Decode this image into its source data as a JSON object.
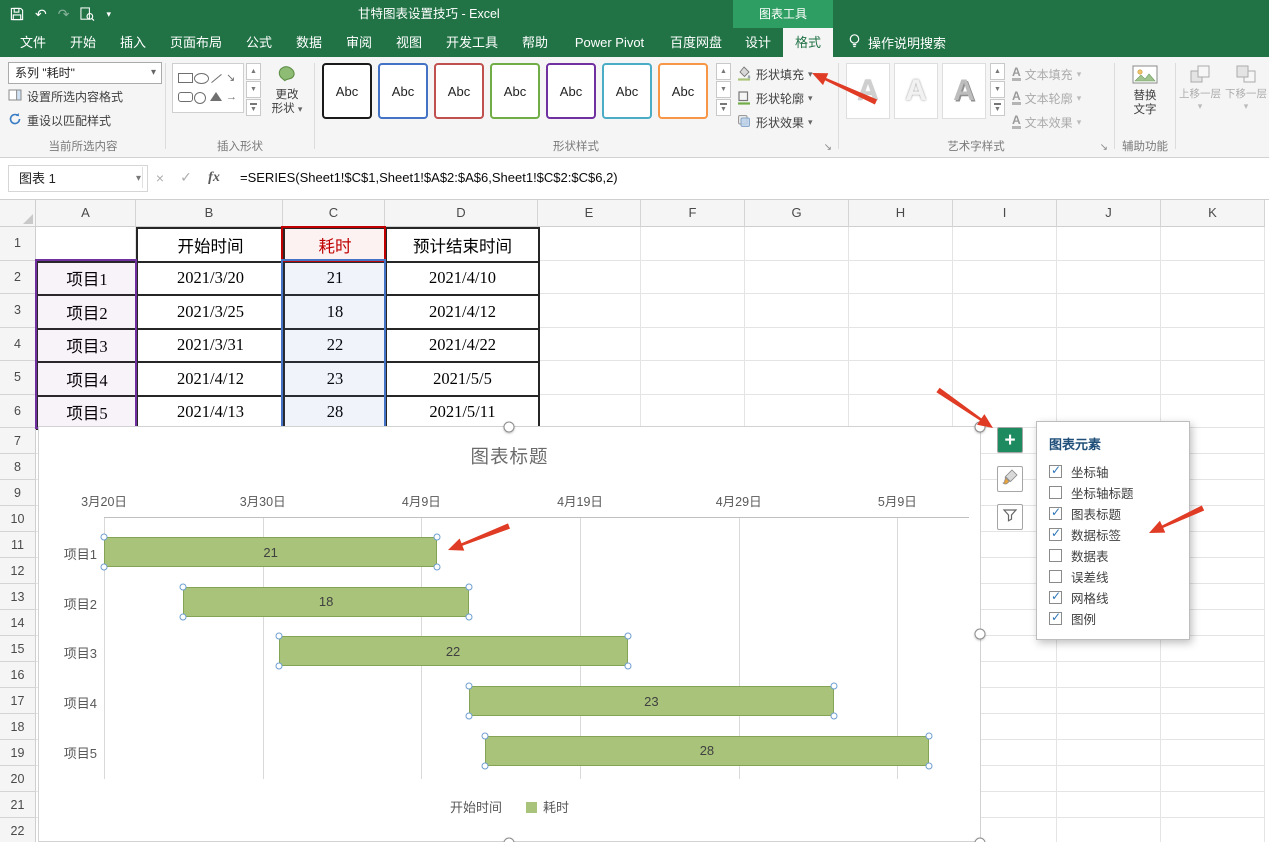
{
  "titlebar": {
    "title": "甘特图表设置技巧 - Excel",
    "contextual_group": "图表工具",
    "qat_icons": [
      "save-icon",
      "undo-icon",
      "redo-icon",
      "print-preview-icon",
      "qat-customize-icon"
    ]
  },
  "tabs": {
    "items": [
      {
        "id": "file",
        "label": "文件"
      },
      {
        "id": "home",
        "label": "开始"
      },
      {
        "id": "insert",
        "label": "插入"
      },
      {
        "id": "page-layout",
        "label": "页面布局"
      },
      {
        "id": "formulas",
        "label": "公式"
      },
      {
        "id": "data",
        "label": "数据"
      },
      {
        "id": "review",
        "label": "审阅"
      },
      {
        "id": "view",
        "label": "视图"
      },
      {
        "id": "developer",
        "label": "开发工具"
      },
      {
        "id": "help",
        "label": "帮助"
      },
      {
        "id": "power-pivot",
        "label": "Power Pivot"
      },
      {
        "id": "baidu-netdisk",
        "label": "百度网盘"
      },
      {
        "id": "design",
        "label": "设计"
      },
      {
        "id": "format",
        "label": "格式"
      }
    ],
    "active": "格式",
    "tell_me": "操作说明搜索"
  },
  "ribbon": {
    "current_selection": {
      "value": "系列 \"耗时\"",
      "buttons": [
        "设置所选内容格式",
        "重设以匹配样式"
      ],
      "group_label": "当前所选内容"
    },
    "insert_shapes": {
      "icons": [
        "rectangle-icon",
        "ellipse-icon",
        "diagonal-line-icon",
        "down-right-arrow-icon",
        "rounded-rectangle-icon",
        "circle-icon",
        "triangle-icon",
        "right-arrow-icon"
      ],
      "change_shape_lines": [
        "更改",
        "形状"
      ],
      "group_label": "插入形状"
    },
    "shape_styles": {
      "preview_label": "Abc",
      "preview_border_colors": [
        "#1a1a1a",
        "#4472c4",
        "#c0504d",
        "#70ad47",
        "#7030a0",
        "#4bacc6",
        "#f79646"
      ],
      "buttons": [
        "形状填充",
        "形状轮廓",
        "形状效果"
      ],
      "group_label": "形状样式"
    },
    "wordart": {
      "letter": "A",
      "buttons": [
        "文本填充",
        "文本轮廓",
        "文本效果"
      ],
      "group_label": "艺术字样式"
    },
    "accessibility": {
      "button_lines": [
        "替换",
        "文字"
      ],
      "group_label": "辅助功能"
    },
    "arrange": {
      "buttons": [
        "上移一层",
        "下移一层"
      ]
    }
  },
  "formula_bar": {
    "name_box": "图表 1",
    "fx_label": "fx",
    "formula": "=SERIES(Sheet1!$C$1,Sheet1!$A$2:$A$6,Sheet1!$C$2:$C$6,2)"
  },
  "sheet": {
    "columns": [
      "A",
      "B",
      "C",
      "D",
      "E",
      "F",
      "G",
      "H",
      "I",
      "J",
      "K"
    ],
    "row_labels": [
      "1",
      "2",
      "3",
      "4",
      "5",
      "6",
      "7",
      "8",
      "9",
      "10",
      "11",
      "12",
      "13",
      "14",
      "15",
      "16",
      "17",
      "18",
      "19",
      "20",
      "21",
      "22"
    ],
    "table": {
      "headers": [
        "",
        "开始时间",
        "耗时",
        "预计结束时间"
      ],
      "rows": [
        [
          "项目1",
          "2021/3/20",
          "21",
          "2021/4/10"
        ],
        [
          "项目2",
          "2021/3/25",
          "18",
          "2021/4/12"
        ],
        [
          "项目3",
          "2021/3/31",
          "22",
          "2021/4/22"
        ],
        [
          "项目4",
          "2021/4/12",
          "23",
          "2021/5/5"
        ],
        [
          "项目5",
          "2021/4/13",
          "28",
          "2021/5/11"
        ]
      ]
    }
  },
  "chart_data": {
    "type": "bar",
    "subtype": "gantt-horizontal",
    "title": "图表标题",
    "categories": [
      "项目1",
      "项目2",
      "项目3",
      "项目4",
      "项目5"
    ],
    "series": [
      {
        "name": "开始时间",
        "values": [
          "2021/3/20",
          "2021/3/25",
          "2021/3/31",
          "2021/4/12",
          "2021/4/13"
        ],
        "hidden": true
      },
      {
        "name": "耗时",
        "values": [
          21,
          18,
          22,
          23,
          28
        ],
        "color": "#a9c47a"
      }
    ],
    "start_offsets_days": [
      0,
      5,
      11,
      23,
      24
    ],
    "x_axis": {
      "position": "top",
      "labels": [
        "3月20日",
        "3月30日",
        "4月9日",
        "4月19日",
        "4月29日",
        "5月9日"
      ],
      "tick_interval_days": 10
    },
    "data_labels": [
      21,
      18,
      22,
      23,
      28
    ],
    "gridlines": true,
    "legend": {
      "position": "bottom",
      "entries": [
        "开始时间",
        "耗时"
      ]
    }
  },
  "chart_elements_popup": {
    "title": "图表元素",
    "items": [
      {
        "label": "坐标轴",
        "checked": true
      },
      {
        "label": "坐标轴标题",
        "checked": false
      },
      {
        "label": "图表标题",
        "checked": true
      },
      {
        "label": "数据标签",
        "checked": true
      },
      {
        "label": "数据表",
        "checked": false
      },
      {
        "label": "误差线",
        "checked": false
      },
      {
        "label": "网格线",
        "checked": true
      },
      {
        "label": "图例",
        "checked": true
      }
    ]
  },
  "chart_buttons": [
    {
      "id": "chart-elements",
      "icon": "plus-icon"
    },
    {
      "id": "chart-styles",
      "icon": "brush-icon"
    },
    {
      "id": "chart-filters",
      "icon": "funnel-icon"
    }
  ],
  "annotations": {
    "arrows": [
      {
        "points_at": "shape-fill-button",
        "from": [
          876,
          102
        ],
        "to": [
          812,
          73
        ]
      },
      {
        "points_at": "chart-elements-button",
        "from": [
          938,
          390
        ],
        "to": [
          993,
          428
        ]
      },
      {
        "points_at": "gantt-bar-1",
        "from": [
          509,
          526
        ],
        "to": [
          448,
          550
        ]
      },
      {
        "points_at": "data-labels-item",
        "from": [
          1203,
          508
        ],
        "to": [
          1149,
          533
        ]
      }
    ]
  },
  "colors": {
    "excel_green": "#217346",
    "contextual_green": "#2f9e62",
    "ribbon_bg": "#f5f5f5",
    "bar_fill": "#a9c47a",
    "bar_border": "#85a355",
    "arrow_red": "#e03b24",
    "range_red": "#c00000",
    "range_purple": "#7030a0",
    "range_blue": "#4472c4",
    "check_blue": "#2e75b6",
    "chart_text": "#595959"
  }
}
